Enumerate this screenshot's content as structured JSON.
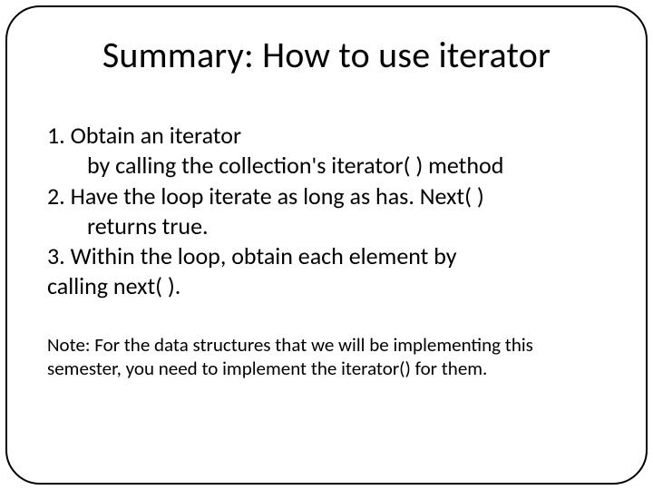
{
  "title": "Summary: How to use iterator",
  "items": {
    "i1_line1": "1. Obtain an iterator",
    "i1_line2": "by calling the collection's iterator( ) method",
    "i2_line1": "2.  Have the loop iterate as long as has. Next( )",
    "i2_line2": "returns true.",
    "i3_line1": "3. Within the loop, obtain each element by",
    "i3_line2": "calling next( )."
  },
  "note_line1": "Note: For the data structures that we will be implementing this",
  "note_line2": "semester, you need to implement the iterator() for them."
}
